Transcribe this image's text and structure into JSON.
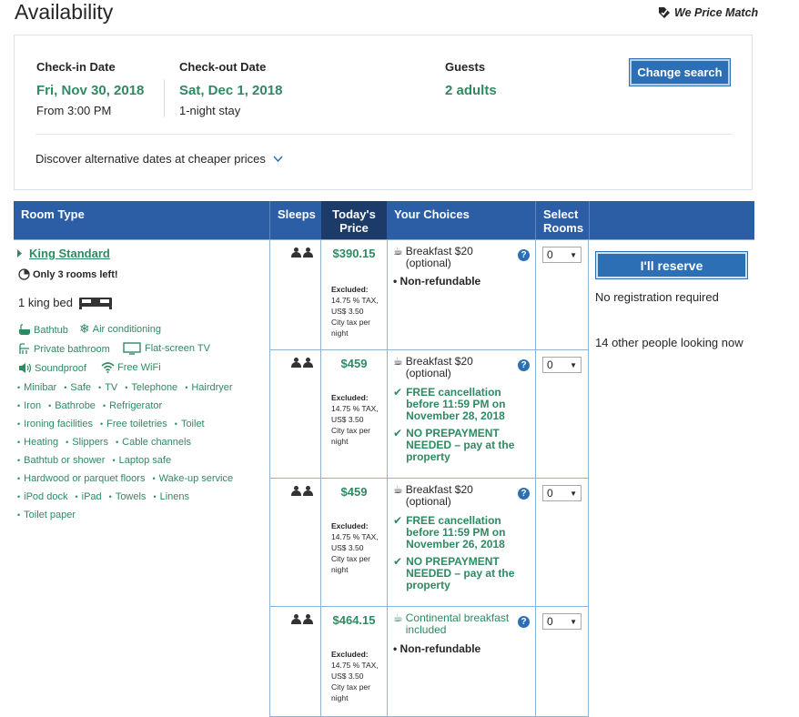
{
  "header": {
    "title": "Availability",
    "price_match": "We Price Match"
  },
  "search": {
    "checkin_label": "Check-in Date",
    "checkin_date": "Fri, Nov 30, 2018",
    "checkin_time": "From 3:00 PM",
    "checkout_label": "Check-out Date",
    "checkout_date": "Sat, Dec 1, 2018",
    "stay_length": "1-night stay",
    "guests_label": "Guests",
    "guests_value": "2 adults",
    "change_button": "Change search",
    "discover_text": "Discover alternative dates at cheaper prices"
  },
  "table": {
    "headers": {
      "room_type": "Room Type",
      "sleeps": "Sleeps",
      "todays_price_1": "Today's",
      "todays_price_2": "Price",
      "your_choices": "Your Choices",
      "select_rooms_1": "Select",
      "select_rooms_2": "Rooms"
    }
  },
  "room": {
    "name": "King Standard",
    "scarcity": "Only 3 rooms left!",
    "bed": "1 king bed",
    "facilities_icons": [
      {
        "icon": "bathtub-icon",
        "label": "Bathtub"
      },
      {
        "icon": "air-conditioning-icon",
        "label": "Air conditioning"
      },
      {
        "icon": "private-bathroom-icon",
        "label": "Private bathroom"
      },
      {
        "icon": "flat-screen-tv-icon",
        "label": "Flat-screen TV"
      },
      {
        "icon": "soundproof-icon",
        "label": "Soundproof"
      },
      {
        "icon": "wifi-icon",
        "label": "Free WiFi"
      }
    ],
    "facility_lines": [
      [
        "Minibar",
        "Safe",
        "TV",
        "Telephone",
        "Hairdryer"
      ],
      [
        "Iron",
        "Bathrobe",
        "Refrigerator"
      ],
      [
        "Ironing facilities",
        "Free toiletries",
        "Toilet"
      ],
      [
        "Heating",
        "Slippers",
        "Cable channels"
      ],
      [
        "Bathtub or shower",
        "Laptop safe"
      ],
      [
        "Hardwood or parquet floors",
        "Wake-up service"
      ],
      [
        "iPod dock",
        "iPad",
        "Towels",
        "Linens"
      ],
      [
        "Toilet paper"
      ]
    ]
  },
  "offers": [
    {
      "price": "$390.15",
      "excluded_label": "Excluded:",
      "excluded_lines": [
        "14.75 % TAX,",
        "US$ 3.50",
        "City tax per",
        "night"
      ],
      "breakfast_1": "Breakfast $20",
      "breakfast_2": "(optional)",
      "c1": "Non-refundable",
      "c2": "",
      "c3": "",
      "c4": "",
      "c5": "",
      "c6": "",
      "select_value": "0"
    },
    {
      "price": "$459",
      "excluded_label": "Excluded:",
      "excluded_lines": [
        "14.75 % TAX,",
        "US$ 3.50",
        "City tax per",
        "night"
      ],
      "breakfast_1": "Breakfast $20",
      "breakfast_2": "(optional)",
      "c1": "FREE cancellation",
      "c2": "before 11:59 PM on",
      "c3": "November 28, 2018",
      "c4": "NO PREPAYMENT",
      "c5": "NEEDED – pay at the",
      "c6": "property",
      "select_value": "0"
    },
    {
      "price": "$459",
      "excluded_label": "Excluded:",
      "excluded_lines": [
        "14.75 % TAX,",
        "US$ 3.50",
        "City tax per",
        "night"
      ],
      "breakfast_1": "Breakfast $20",
      "breakfast_2": "(optional)",
      "c1": "FREE cancellation",
      "c2": "before 11:59 PM on",
      "c3": "November 26, 2018",
      "c4": "NO PREPAYMENT",
      "c5": "NEEDED – pay at the",
      "c6": "property",
      "select_value": "0"
    },
    {
      "price": "$464.15",
      "excluded_label": "Excluded:",
      "excluded_lines": [
        "14.75 % TAX,",
        "US$ 3.50",
        "City tax per",
        "night"
      ],
      "breakfast_1": "Continental breakfast",
      "breakfast_2": "included",
      "c1": "Non-refundable",
      "c2": "",
      "c3": "",
      "c4": "",
      "c5": "",
      "c6": "",
      "select_value": "0"
    }
  ],
  "reserve": {
    "button": "I'll reserve",
    "no_registration": "No registration required",
    "people_looking": "14 other people looking now"
  },
  "colors": {
    "brand_blue": "#2c5ea6",
    "accent_green": "#2e8a62",
    "dark_header": "#1c3b68"
  }
}
